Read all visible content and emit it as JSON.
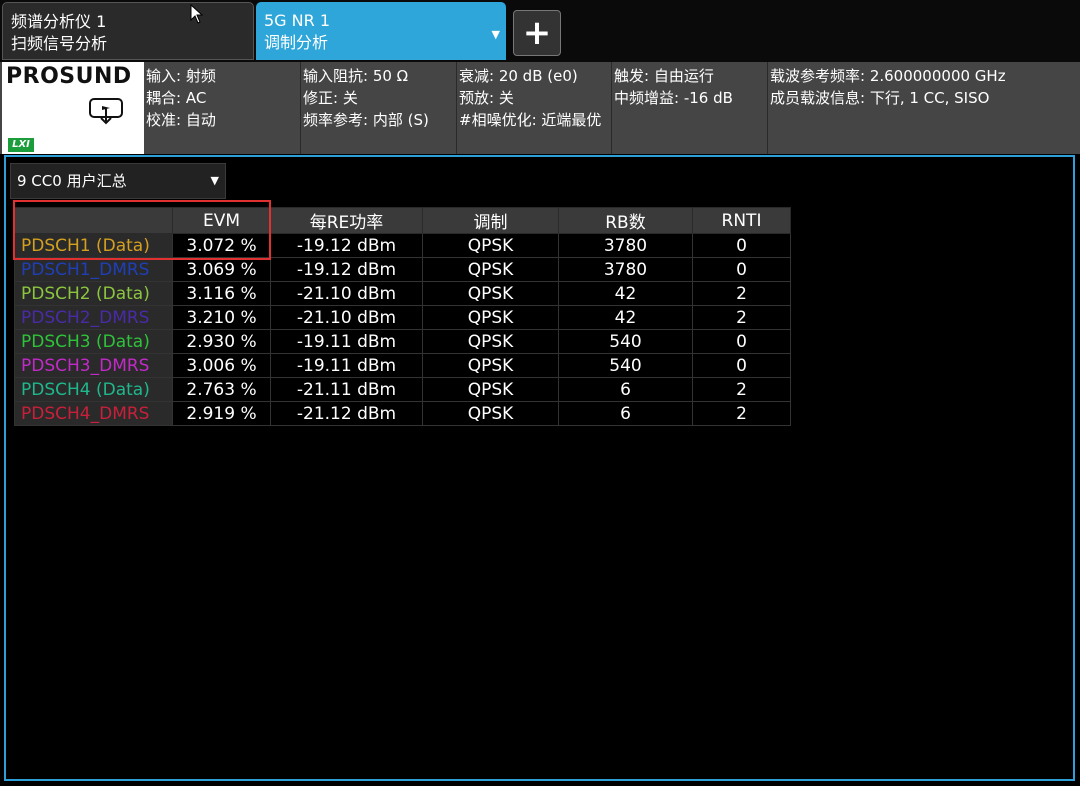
{
  "tabs": [
    {
      "line1": "频谱分析仪 1",
      "line2": "扫频信号分析"
    },
    {
      "line1": "5G NR 1",
      "line2": "调制分析"
    }
  ],
  "add_label": "+",
  "brand": {
    "name": "PROSUND",
    "lxi": "LXI"
  },
  "info_columns": [
    [
      "输入: 射频",
      "耦合: AC",
      "校准: 自动"
    ],
    [
      "输入阻抗: 50 Ω",
      "修正: 关",
      "频率参考: 内部 (S)"
    ],
    [
      "衰减: 20 dB (e0)",
      "预放: 关",
      "#相噪优化: 近端最优"
    ],
    [
      "触发: 自由运行",
      "中频增益: -16 dB"
    ],
    [
      "载波参考频率: 2.600000000 GHz",
      "成员载波信息: 下行, 1 CC, SISO"
    ]
  ],
  "view_select": "9 CC0 用户汇总",
  "table": {
    "headers": [
      "",
      "EVM",
      "每RE功率",
      "调制",
      "RB数",
      "RNTI"
    ],
    "rows": [
      {
        "label": "PDSCH1 (Data)",
        "color": "#d4a020",
        "evm": "3.072 %",
        "power": "-19.12 dBm",
        "mod": "QPSK",
        "rb": "3780",
        "rnti": "0"
      },
      {
        "label": "PDSCH1_DMRS",
        "color": "#1f3fb8",
        "evm": "3.069 %",
        "power": "-19.12 dBm",
        "mod": "QPSK",
        "rb": "3780",
        "rnti": "0"
      },
      {
        "label": "PDSCH2 (Data)",
        "color": "#8cc63f",
        "evm": "3.116 %",
        "power": "-21.10 dBm",
        "mod": "QPSK",
        "rb": "42",
        "rnti": "2"
      },
      {
        "label": "PDSCH2_DMRS",
        "color": "#4a2aa8",
        "evm": "3.210 %",
        "power": "-21.10 dBm",
        "mod": "QPSK",
        "rb": "42",
        "rnti": "2"
      },
      {
        "label": "PDSCH3 (Data)",
        "color": "#2ec43a",
        "evm": "2.930 %",
        "power": "-19.11 dBm",
        "mod": "QPSK",
        "rb": "540",
        "rnti": "0"
      },
      {
        "label": "PDSCH3_DMRS",
        "color": "#c22ac8",
        "evm": "3.006 %",
        "power": "-19.11 dBm",
        "mod": "QPSK",
        "rb": "540",
        "rnti": "0"
      },
      {
        "label": "PDSCH4 (Data)",
        "color": "#1fb88c",
        "evm": "2.763 %",
        "power": "-21.11 dBm",
        "mod": "QPSK",
        "rb": "6",
        "rnti": "2"
      },
      {
        "label": "PDSCH4_DMRS",
        "color": "#c8203a",
        "evm": "2.919 %",
        "power": "-21.12 dBm",
        "mod": "QPSK",
        "rb": "6",
        "rnti": "2"
      }
    ]
  },
  "colors": {
    "accent": "#2ea6d9",
    "highlight": "#e03030"
  }
}
